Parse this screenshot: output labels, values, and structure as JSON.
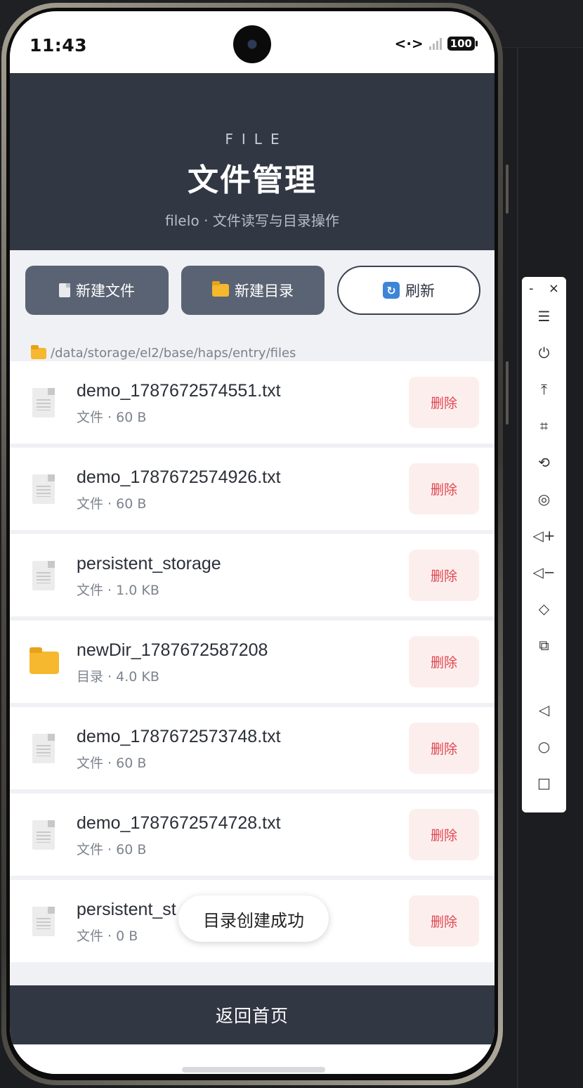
{
  "status_bar": {
    "time": "11:43",
    "network_icon": "<·>",
    "battery": "100"
  },
  "header": {
    "subtitle": "FILE",
    "title": "文件管理",
    "description": "fileIo · 文件读写与目录操作"
  },
  "toolbar": {
    "new_file_label": "新建文件",
    "new_dir_label": "新建目录",
    "refresh_label": "刷新"
  },
  "path": "/data/storage/el2/base/haps/entry/files",
  "files": [
    {
      "name": "demo_1787672574551.txt",
      "meta": "文件 · 60 B",
      "type": "file",
      "delete_label": "删除"
    },
    {
      "name": "demo_1787672574926.txt",
      "meta": "文件 · 60 B",
      "type": "file",
      "delete_label": "删除"
    },
    {
      "name": "persistent_storage",
      "meta": "文件 · 1.0 KB",
      "type": "file",
      "delete_label": "删除"
    },
    {
      "name": "newDir_1787672587208",
      "meta": "目录 · 4.0 KB",
      "type": "dir",
      "delete_label": "删除"
    },
    {
      "name": "demo_1787672573748.txt",
      "meta": "文件 · 60 B",
      "type": "file",
      "delete_label": "删除"
    },
    {
      "name": "demo_1787672574728.txt",
      "meta": "文件 · 60 B",
      "type": "file",
      "delete_label": "删除"
    },
    {
      "name": "persistent_st",
      "meta": "文件 · 0 B",
      "type": "file",
      "delete_label": "删除"
    }
  ],
  "toast": "目录创建成功",
  "bottom_bar": {
    "back_label": "返回首页"
  },
  "emulator_tools": {
    "minimize": "-",
    "close": "×",
    "icons": [
      "menu-icon",
      "power-icon",
      "pin-top-icon",
      "crop-icon",
      "rotate-icon",
      "screenshot-icon",
      "volume-up-icon",
      "volume-down-icon",
      "shake-icon",
      "multi-screen-icon",
      "back-icon",
      "home-icon",
      "recents-icon"
    ]
  },
  "colors": {
    "header_bg": "#323744",
    "button_bg": "#5a6373",
    "delete_text": "#e0474f",
    "delete_bg": "#fdeeee",
    "folder": "#f5b82e"
  }
}
